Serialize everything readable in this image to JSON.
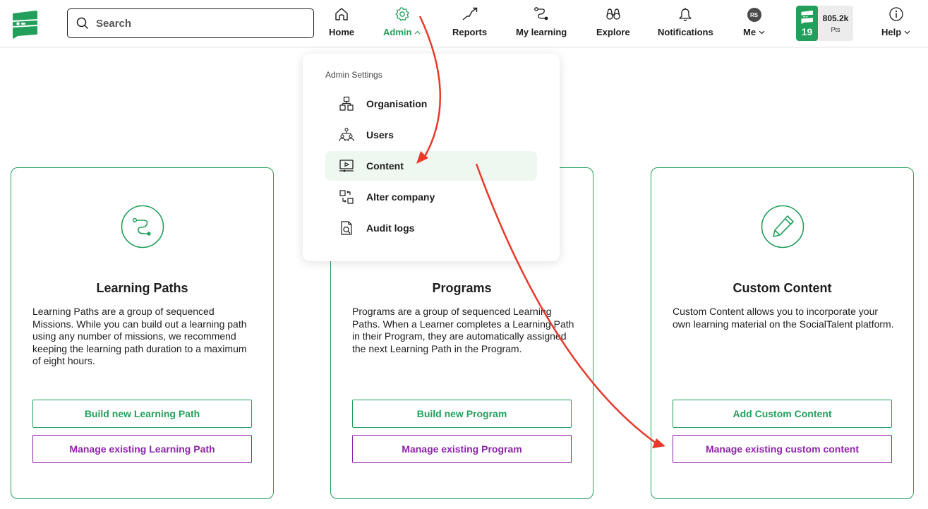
{
  "header": {
    "logo_icon": "socialtalent-logo-icon",
    "search": {
      "placeholder": "Search",
      "value": "",
      "icon": "search-icon"
    },
    "nav": [
      {
        "label": "Home",
        "icon": "home-icon",
        "active": false
      },
      {
        "label": "Admin",
        "icon": "gear-icon",
        "active": true,
        "expanded": true
      },
      {
        "label": "Reports",
        "icon": "trend-icon",
        "active": false
      },
      {
        "label": "My learning",
        "icon": "path-icon",
        "active": false
      },
      {
        "label": "Explore",
        "icon": "binoculars-icon",
        "active": false
      },
      {
        "label": "Notifications",
        "icon": "bell-icon",
        "active": false
      },
      {
        "label": "Me",
        "avatar_initials": "RS",
        "active": false
      },
      {
        "label": "Help",
        "icon": "info-icon",
        "active": false
      }
    ],
    "points": {
      "level": "19",
      "value": "805.2k",
      "unit": "Pts"
    }
  },
  "admin_dropdown": {
    "header": "Admin Settings",
    "items": [
      {
        "label": "Organisation",
        "icon": "organisation-icon",
        "highlighted": false
      },
      {
        "label": "Users",
        "icon": "users-icon",
        "highlighted": false
      },
      {
        "label": "Content",
        "icon": "content-video-icon",
        "highlighted": true
      },
      {
        "label": "Alter company",
        "icon": "switch-company-icon",
        "highlighted": false
      },
      {
        "label": "Audit logs",
        "icon": "audit-document-icon",
        "highlighted": false
      }
    ]
  },
  "cards": [
    {
      "title": "Learning Paths",
      "icon": "learning-path-icon",
      "description": "Learning Paths are a group of sequenced Missions. While you can build out a learning path using any number of missions, we recommend keeping the learning path duration to a maximum of eight hours.",
      "primary_button": "Build new Learning Path",
      "secondary_button": "Manage existing Learning Path"
    },
    {
      "title": "Programs",
      "icon": "programs-icon",
      "description": "Programs are a group of sequenced Learning Paths. When a Learner completes a Learning Path in their Program, they are automatically assigned the next Learning Path in the Program.",
      "primary_button": "Build new Program",
      "secondary_button": "Manage existing Program"
    },
    {
      "title": "Custom Content",
      "icon": "pencil-icon",
      "description": "Custom Content allows you to incorporate your own learning material on the SocialTalent platform.",
      "primary_button": "Add Custom Content",
      "secondary_button": "Manage existing custom content"
    }
  ],
  "colors": {
    "brand_green": "#22a05b",
    "secondary_purple": "#8e24aa",
    "highlight_bg": "#eef8f1",
    "annotation_red": "#e8392b"
  }
}
